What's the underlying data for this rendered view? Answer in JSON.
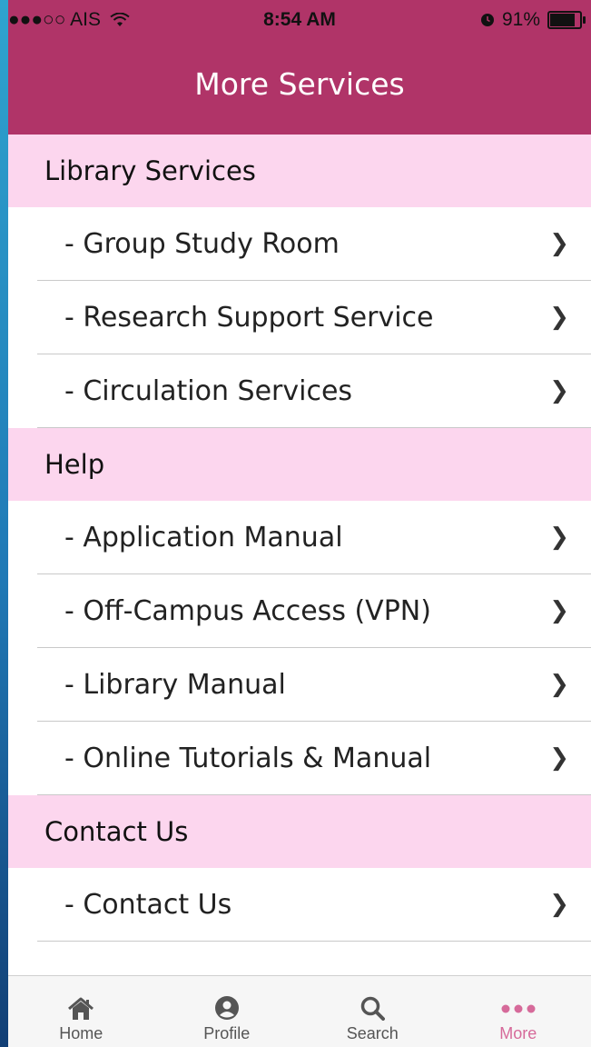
{
  "status_bar": {
    "carrier": "●●●○○ AIS",
    "time": "8:54 AM",
    "battery": "91%",
    "battery_level": 0.91
  },
  "nav": {
    "title": "More Services"
  },
  "sections": [
    {
      "title": "Library Services",
      "items": [
        {
          "label": "- Group Study Room",
          "chevron": "❯"
        },
        {
          "label": "- Research Support Service",
          "chevron": "❯"
        },
        {
          "label": "- Circulation Services",
          "chevron": "❯"
        }
      ]
    },
    {
      "title": "Help",
      "items": [
        {
          "label": "- Application Manual",
          "chevron": "❯"
        },
        {
          "label": "- Off-Campus Access (VPN)",
          "chevron": "❯"
        },
        {
          "label": "- Library Manual",
          "chevron": "❯"
        },
        {
          "label": "- Online Tutorials & Manual",
          "chevron": "❯"
        }
      ]
    },
    {
      "title": "Contact Us",
      "items": [
        {
          "label": "- Contact Us",
          "chevron": "❯"
        }
      ]
    }
  ],
  "tab_bar": {
    "tabs": [
      {
        "label": "Home",
        "icon": "home-icon"
      },
      {
        "label": "Profile",
        "icon": "profile-icon"
      },
      {
        "label": "Search",
        "icon": "search-icon"
      },
      {
        "label": "More",
        "icon": "more-icon",
        "active": true
      }
    ]
  },
  "colors": {
    "header": "#b03468",
    "section_bg": "#fcd6ee",
    "active_tab": "#d66a9a"
  }
}
